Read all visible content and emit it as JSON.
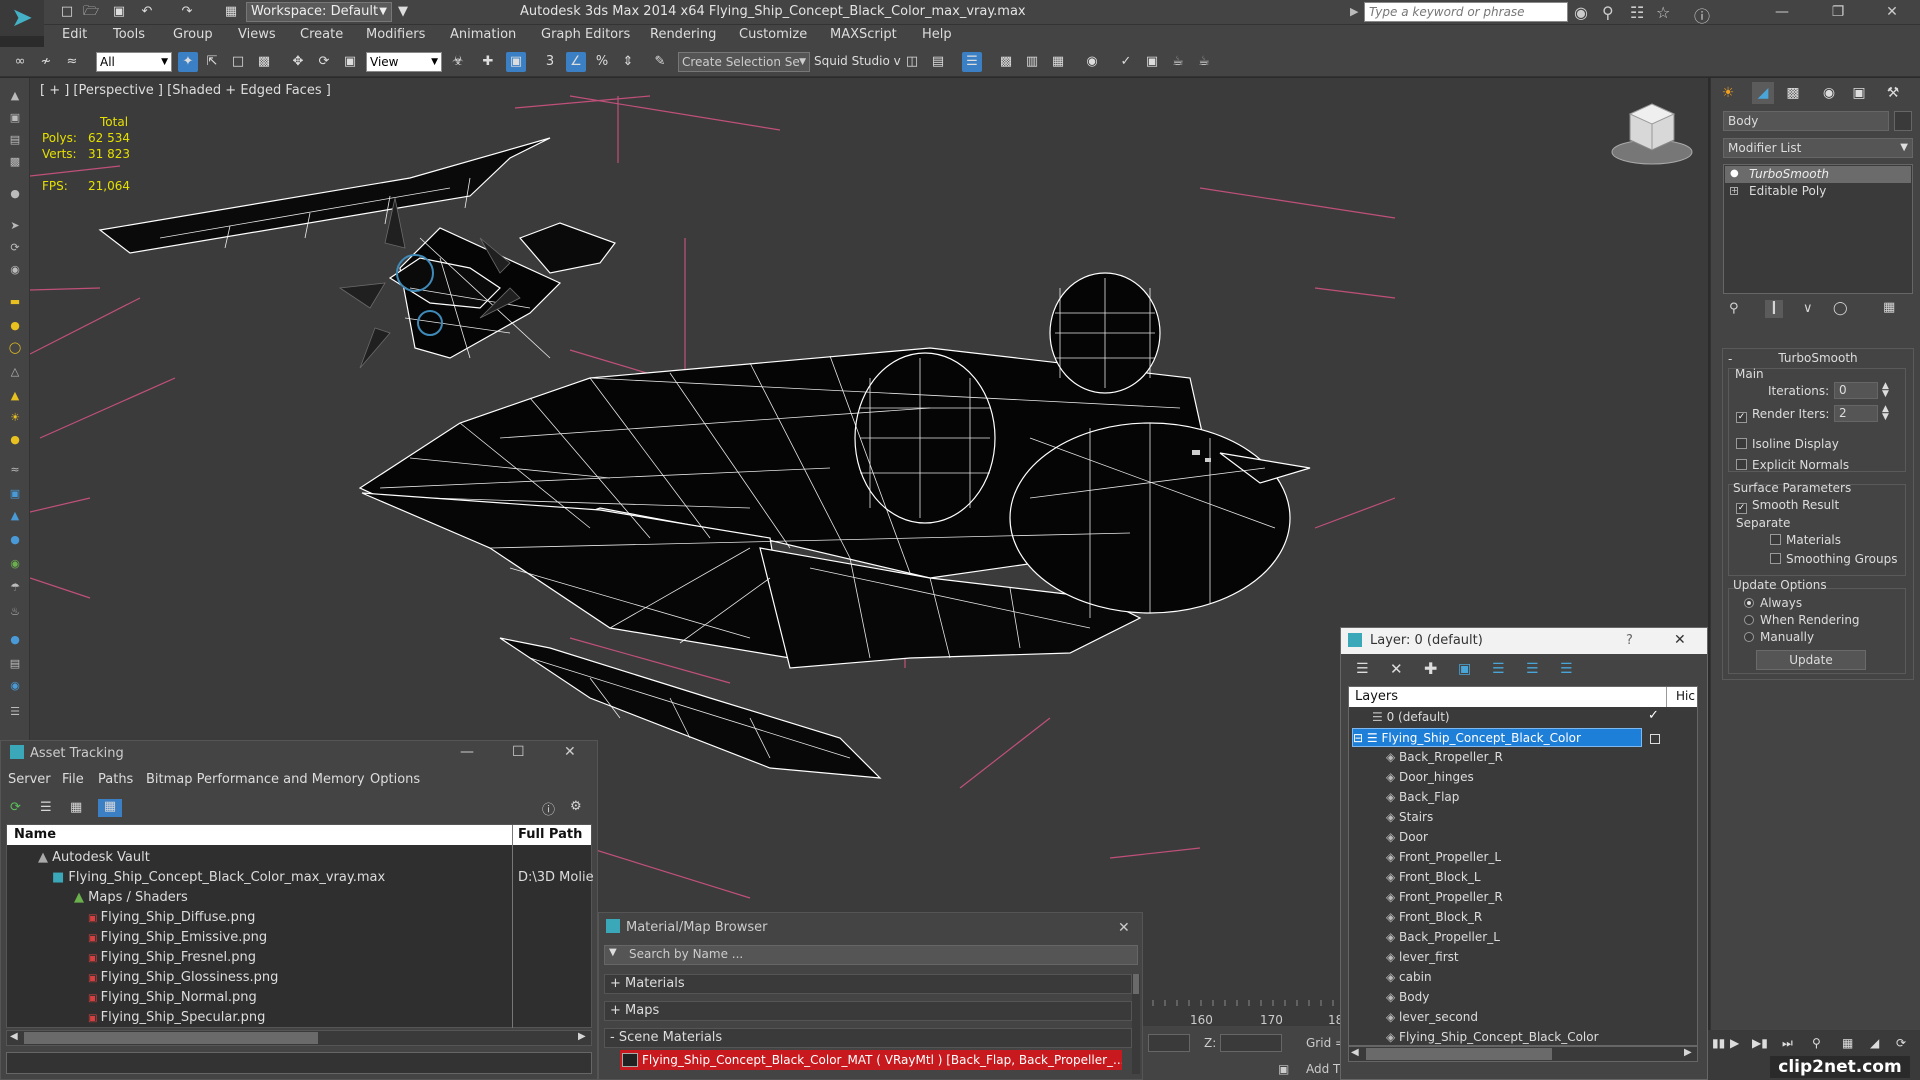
{
  "titlebar": {
    "workspace": "Workspace: Default",
    "title": "Autodesk 3ds Max  2014 x64     Flying_Ship_Concept_Black_Color_max_vray.max",
    "search_placeholder": "Type a keyword or phrase"
  },
  "menu": [
    "Edit",
    "Tools",
    "Group",
    "Views",
    "Create",
    "Modifiers",
    "Animation",
    "Graph Editors",
    "Rendering",
    "Customize",
    "MAXScript",
    "Help"
  ],
  "toolbar": {
    "filter_select": "All",
    "refcoord_select": "View",
    "selection_set": "Create Selection Se",
    "squid_label": "Squid Studio v"
  },
  "viewport": {
    "label": "[ + ] [Perspective ] [Shaded + Edged Faces ]",
    "stats": {
      "total_label": "Total",
      "polys_label": "Polys:",
      "polys_value": "62 534",
      "verts_label": "Verts:",
      "verts_value": "31 823",
      "fps_label": "FPS:",
      "fps_value": "21,064"
    }
  },
  "cmdpanel": {
    "object_name": "Body",
    "modifier_list": "Modifier List",
    "stack": [
      "TurboSmooth",
      "Editable Poly"
    ],
    "rollout_title": "TurboSmooth",
    "main_label": "Main",
    "iterations_label": "Iterations:",
    "iterations_value": "0",
    "render_iters_label": "Render Iters:",
    "render_iters_value": "2",
    "isoline": "Isoline Display",
    "explicit_normals": "Explicit Normals",
    "surface_params": "Surface Parameters",
    "smooth_result": "Smooth Result",
    "separate": "Separate",
    "materials": "Materials",
    "smoothing_groups": "Smoothing Groups",
    "update_options": "Update Options",
    "always": "Always",
    "when_rendering": "When Rendering",
    "manually": "Manually",
    "update_button": "Update"
  },
  "asset": {
    "title": "Asset Tracking",
    "menu": [
      "Server",
      "File",
      "Paths",
      "Bitmap Performance and Memory",
      "Options"
    ],
    "col_name": "Name",
    "col_path": "Full Path",
    "rows": [
      {
        "name": "Autodesk Vault",
        "path": ""
      },
      {
        "name": "Flying_Ship_Concept_Black_Color_max_vray.max",
        "path": "D:\\3D Molie"
      },
      {
        "name": "Maps / Shaders",
        "path": ""
      },
      {
        "name": "Flying_Ship_Diffuse.png",
        "path": ""
      },
      {
        "name": "Flying_Ship_Emissive.png",
        "path": ""
      },
      {
        "name": "Flying_Ship_Fresnel.png",
        "path": ""
      },
      {
        "name": "Flying_Ship_Glossiness.png",
        "path": ""
      },
      {
        "name": "Flying_Ship_Normal.png",
        "path": ""
      },
      {
        "name": "Flying_Ship_Specular.png",
        "path": ""
      }
    ]
  },
  "matbrowser": {
    "title": "Material/Map Browser",
    "search_placeholder": "Search by Name ...",
    "materials": "+ Materials",
    "maps": "+ Maps",
    "scene_materials": "- Scene Materials",
    "scene_item": "Flying_Ship_Concept_Black_Color_MAT ( VRayMtl ) [Back_Flap, Back_Propeller_..."
  },
  "layer": {
    "title": "Layer: 0 (default)",
    "help": "?",
    "col_layers": "Layers",
    "col_hide": "Hic",
    "items": [
      {
        "name": "0 (default)",
        "level": 0
      },
      {
        "name": "Flying_Ship_Concept_Black_Color",
        "level": 0
      },
      {
        "name": "Back_Rropeller_R",
        "level": 1
      },
      {
        "name": "Door_hinges",
        "level": 1
      },
      {
        "name": "Back_Flap",
        "level": 1
      },
      {
        "name": "Stairs",
        "level": 1
      },
      {
        "name": "Door",
        "level": 1
      },
      {
        "name": "Front_Propeller_L",
        "level": 1
      },
      {
        "name": "Front_Block_L",
        "level": 1
      },
      {
        "name": "Front_Propeller_R",
        "level": 1
      },
      {
        "name": "Front_Block_R",
        "level": 1
      },
      {
        "name": "Back_Propeller_L",
        "level": 1
      },
      {
        "name": "lever_first",
        "level": 1
      },
      {
        "name": "cabin",
        "level": 1
      },
      {
        "name": "Body",
        "level": 1
      },
      {
        "name": "lever_second",
        "level": 1
      },
      {
        "name": "Flying_Ship_Concept_Black_Color",
        "level": 1
      }
    ]
  },
  "timeline": {
    "ticks": [
      "160",
      "170",
      "18"
    ],
    "z_label": "Z:",
    "grid_label": "Grid =",
    "add_t": "Add T"
  },
  "watermark": "clip2net.com",
  "colors": {
    "accent": "#3b7fc4",
    "stats_yellow": "#e5e000",
    "selection_red": "#c8191e"
  }
}
